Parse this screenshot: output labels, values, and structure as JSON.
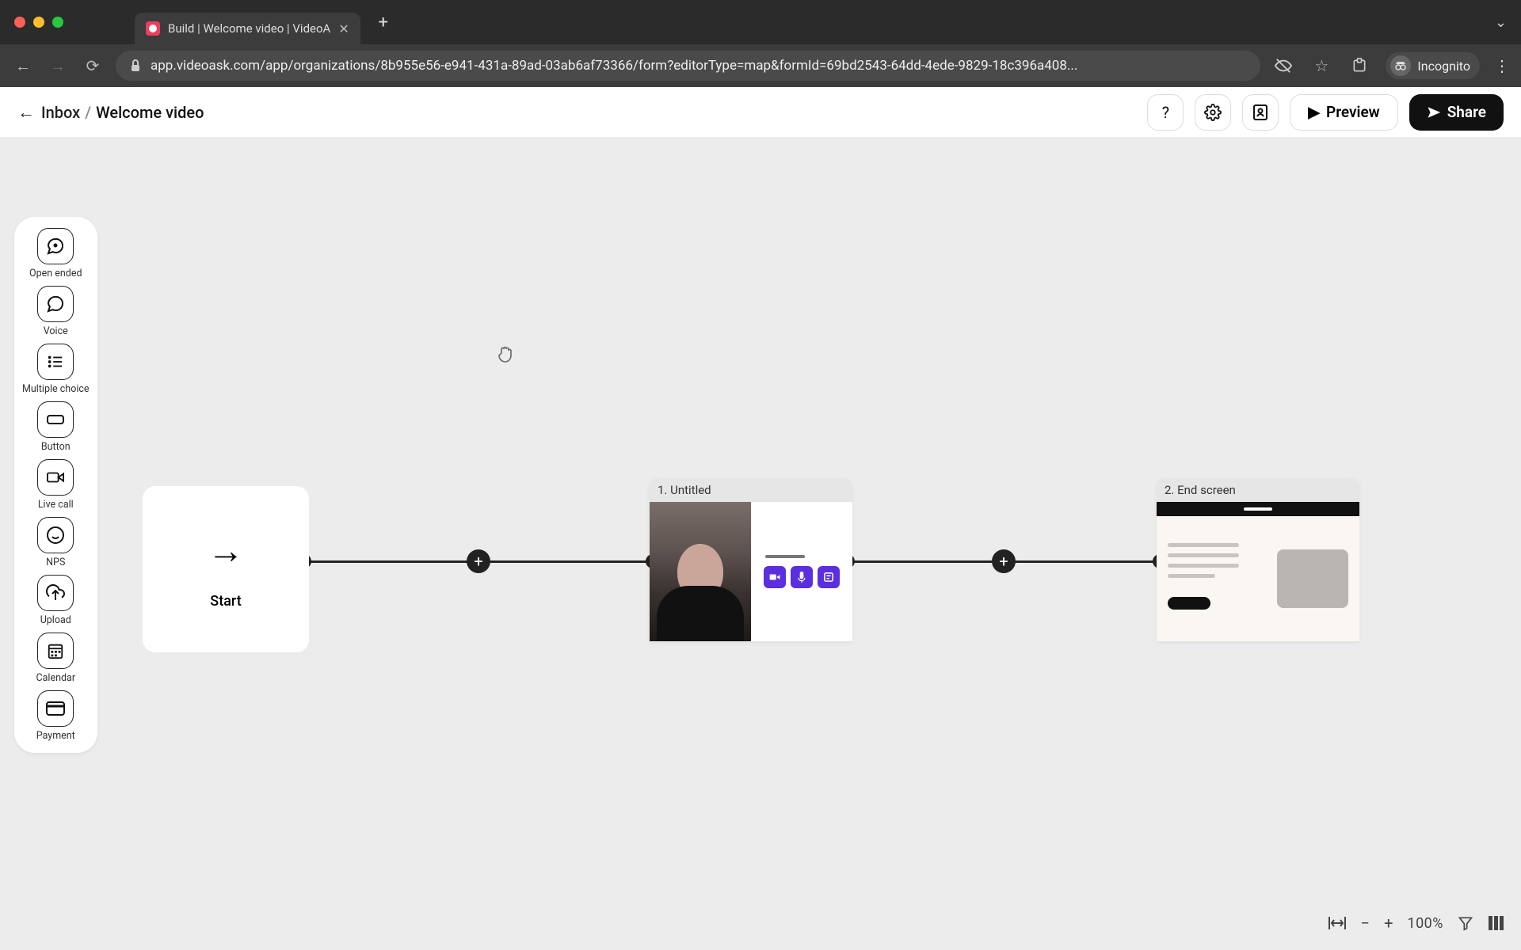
{
  "browser": {
    "tab_title": "Build | Welcome video | VideoA",
    "url": "app.videoask.com/app/organizations/8b955e56-e941-431a-89ad-03ab6af73366/form?editorType=map&formId=69bd2543-64dd-4ede-9829-18c396a408...",
    "incognito_label": "Incognito"
  },
  "header": {
    "breadcrumb_parent": "Inbox",
    "breadcrumb_page": "Welcome video",
    "preview_label": "Preview",
    "share_label": "Share"
  },
  "toolbox": {
    "open_ended": "Open ended",
    "voice": "Voice",
    "multiple_choice": "Multiple choice",
    "button": "Button",
    "live_call": "Live call",
    "nps": "NPS",
    "upload": "Upload",
    "calendar": "Calendar",
    "payment": "Payment"
  },
  "flow": {
    "start_label": "Start",
    "step1_title": "1. Untitled",
    "end_title": "2. End screen"
  },
  "zoom": {
    "percent": "100%"
  }
}
